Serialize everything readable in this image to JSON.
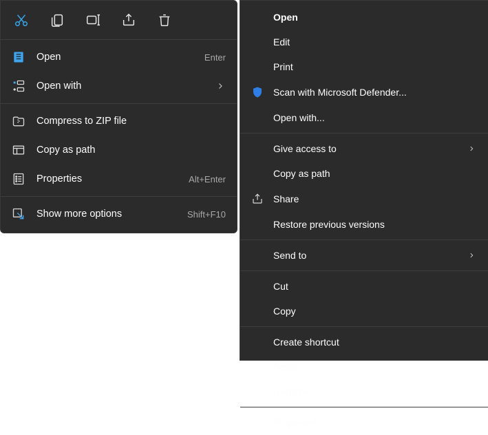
{
  "left_menu": {
    "toolbar": {
      "cut": "cut",
      "copy": "copy",
      "rename": "rename",
      "share": "share",
      "delete": "delete"
    },
    "items": {
      "open": {
        "label": "Open",
        "hint": "Enter"
      },
      "open_with": {
        "label": "Open with"
      },
      "compress": {
        "label": "Compress to ZIP file"
      },
      "copy_path": {
        "label": "Copy as path"
      },
      "properties": {
        "label": "Properties",
        "hint": "Alt+Enter"
      },
      "show_more": {
        "label": "Show more options",
        "hint": "Shift+F10"
      }
    }
  },
  "right_menu": {
    "items": {
      "open": {
        "label": "Open"
      },
      "edit": {
        "label": "Edit"
      },
      "print": {
        "label": "Print"
      },
      "scan": {
        "label": "Scan with Microsoft Defender..."
      },
      "open_with": {
        "label": "Open with..."
      },
      "give_access": {
        "label": "Give access to"
      },
      "copy_path": {
        "label": "Copy as path"
      },
      "share": {
        "label": "Share"
      },
      "restore": {
        "label": "Restore previous versions"
      },
      "send_to": {
        "label": "Send to"
      },
      "cut": {
        "label": "Cut"
      },
      "copy": {
        "label": "Copy"
      },
      "create_shortcut": {
        "label": "Create shortcut"
      },
      "delete": {
        "label": "Delete"
      },
      "rename": {
        "label": "Rename"
      },
      "properties": {
        "label": "Properties"
      }
    }
  }
}
